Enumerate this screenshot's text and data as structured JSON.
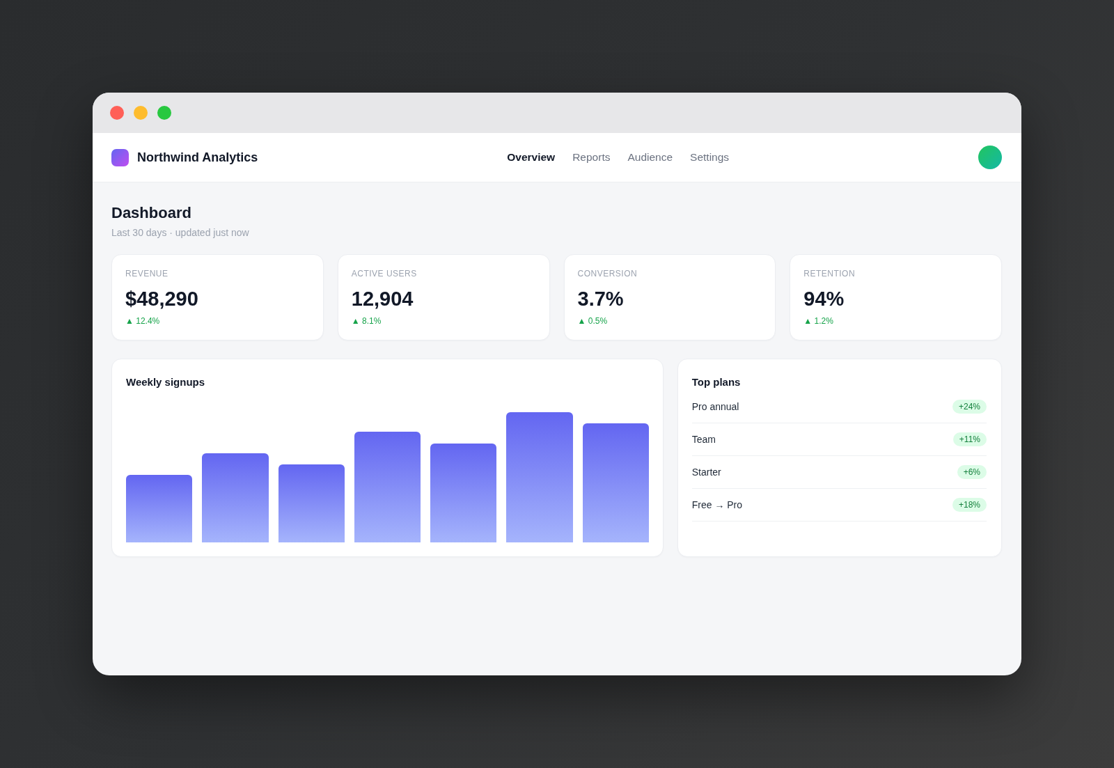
{
  "app": {
    "name": "Northwind Analytics"
  },
  "nav": [
    {
      "label": "Overview",
      "selected": true
    },
    {
      "label": "Reports",
      "selected": false
    },
    {
      "label": "Audience",
      "selected": false
    },
    {
      "label": "Settings",
      "selected": false
    }
  ],
  "header": {
    "title": "Dashboard",
    "subtitle": "Last 30 days · updated just now"
  },
  "stats": [
    {
      "label": "REVENUE",
      "value": "$48,290",
      "delta": "▲ 12.4%"
    },
    {
      "label": "ACTIVE USERS",
      "value": "12,904",
      "delta": "▲ 8.1%"
    },
    {
      "label": "CONVERSION",
      "value": "3.7%",
      "delta": "▲ 0.5%"
    },
    {
      "label": "RETENTION",
      "value": "94%",
      "delta": "▲ 1.2%"
    }
  ],
  "signups": {
    "title": "Weekly signups"
  },
  "top_plans": {
    "title": "Top plans",
    "rows": [
      {
        "name": "Pro annual",
        "change": "+24%"
      },
      {
        "name": "Team",
        "change": "+11%"
      },
      {
        "name": "Starter",
        "change": "+6%"
      },
      {
        "name": "Free → Pro",
        "change": "+18%"
      }
    ]
  }
}
